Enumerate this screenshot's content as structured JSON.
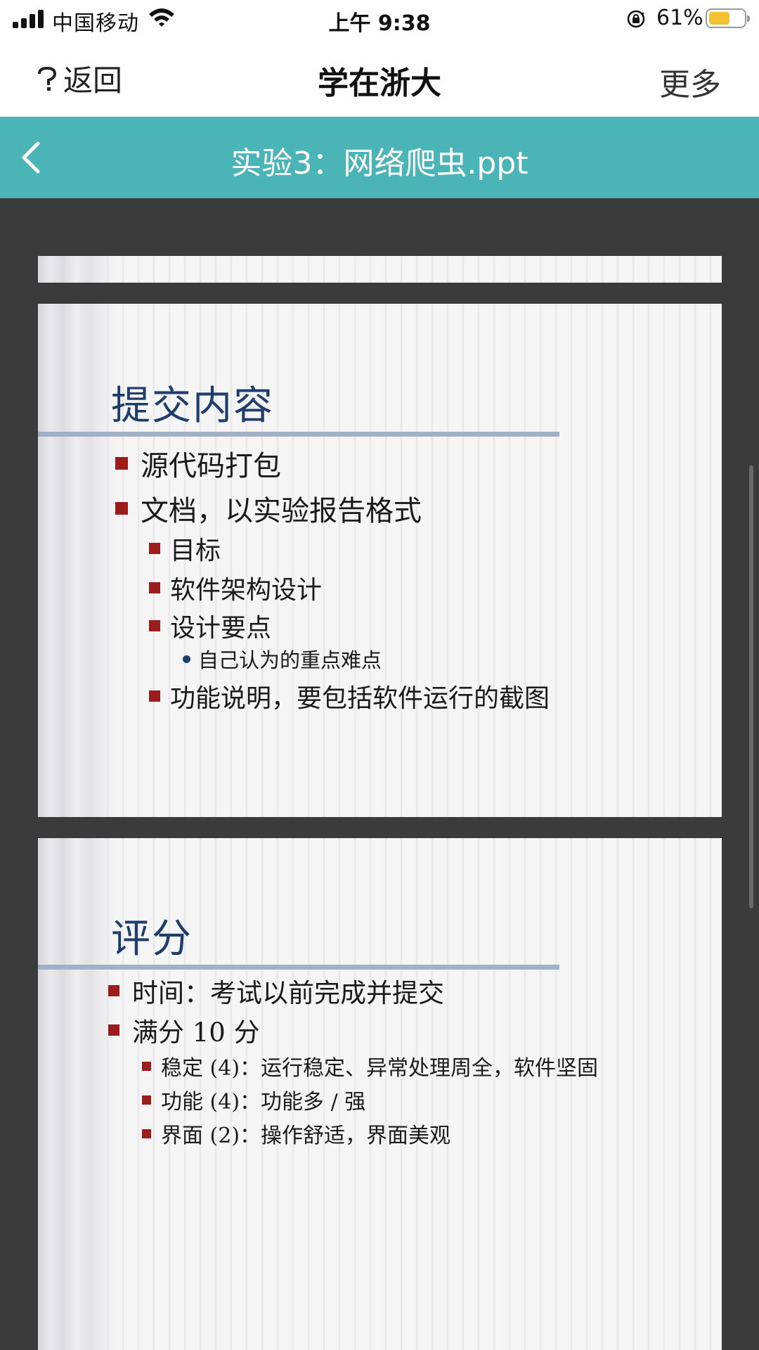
{
  "status_bar": {
    "carrier": "中国移动",
    "time": "上午 9:38",
    "battery_percent_text": "61%",
    "battery_level": 0.61,
    "battery_color": "#f3c234"
  },
  "nav": {
    "back_label": "返回",
    "title": "学在浙大",
    "more_label": "更多"
  },
  "document": {
    "title": "实验3：网络爬虫.ppt",
    "bar_color": "#4bb4b6"
  },
  "slides": [
    {},
    {
      "title": "提交内容",
      "bullets": [
        "源代码打包",
        "文档，以实验报告格式",
        "目标",
        "软件架构设计",
        "设计要点",
        "自己认为的重点难点",
        "功能说明，要包括软件运行的截图"
      ]
    },
    {
      "title": "评分",
      "bullets": [
        "时间：考试以前完成并提交",
        "满分 10 分",
        "稳定 (4)：运行稳定、异常处理周全，软件坚固",
        "功能 (4)：功能多 / 强",
        "界面 (2)：操作舒适，界面美观"
      ]
    }
  ]
}
